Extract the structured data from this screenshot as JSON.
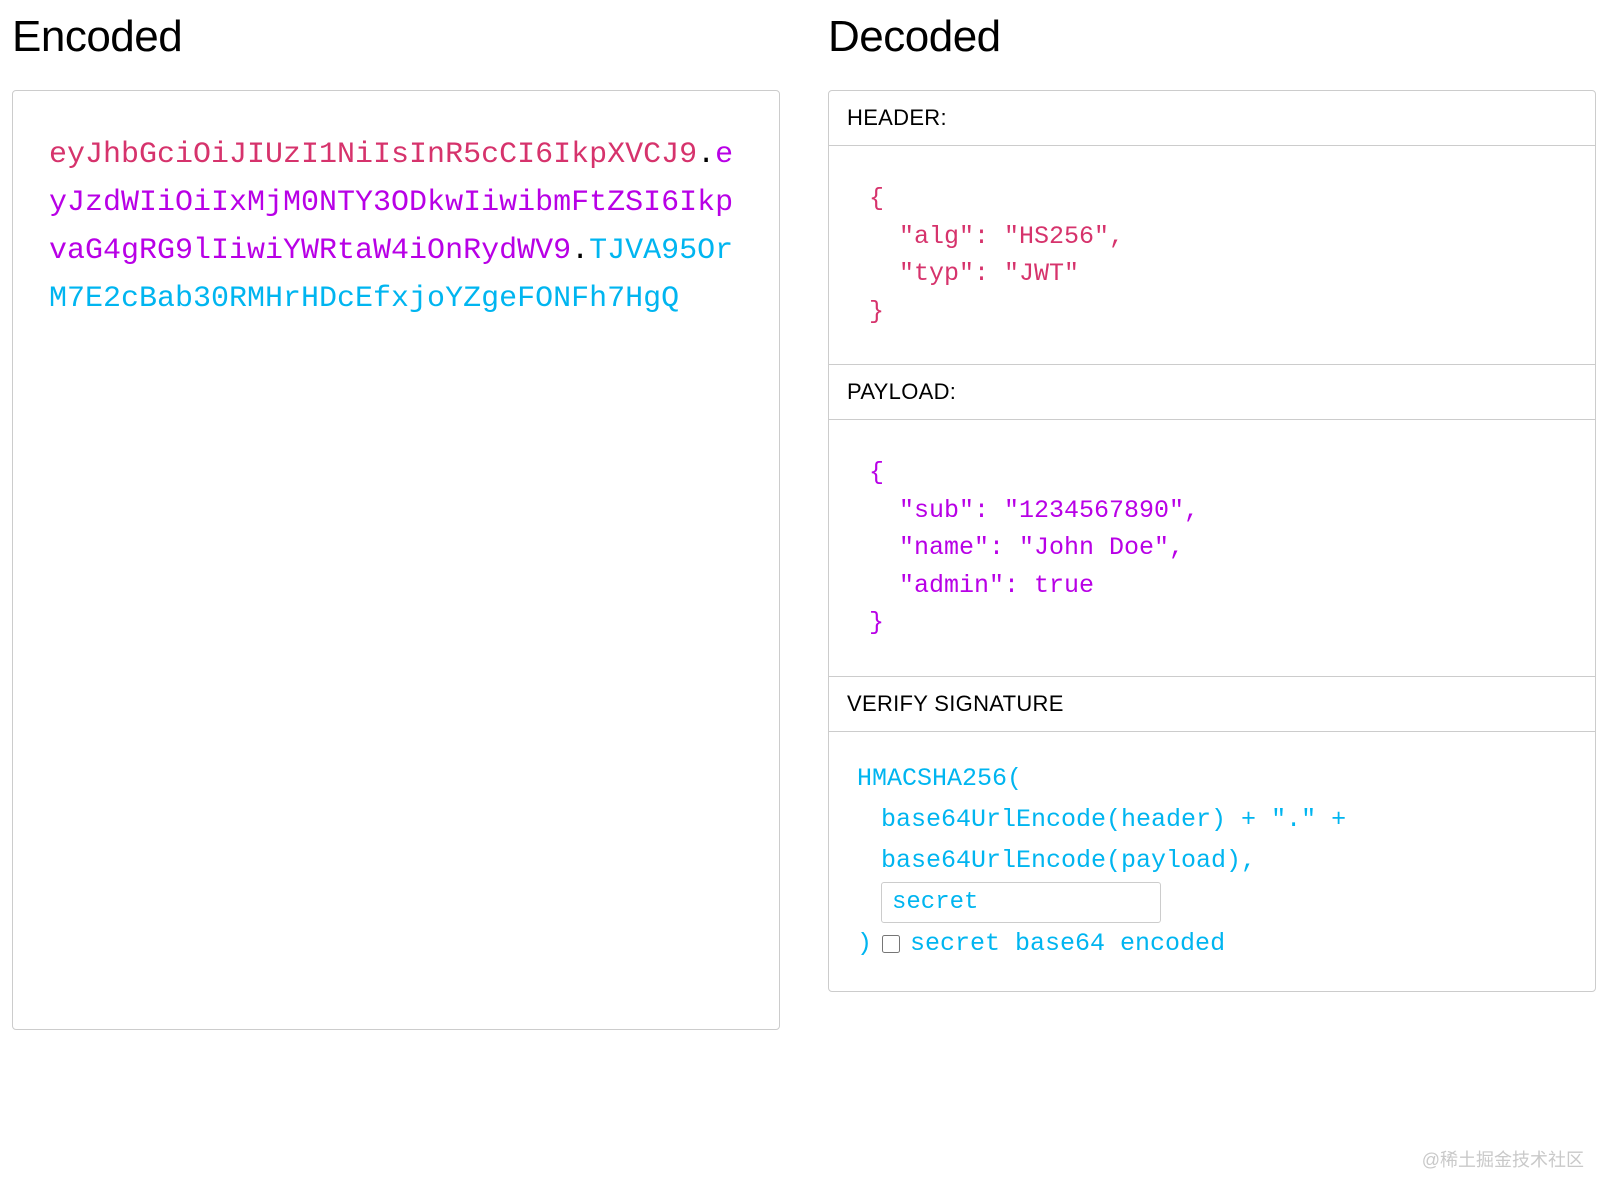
{
  "titles": {
    "encoded": "Encoded",
    "decoded": "Decoded"
  },
  "token": {
    "header": "eyJhbGciOiJIUzI1NiIsInR5cCI6IkpXVCJ9",
    "payload": "eyJzdWIiOiIxMjM0NTY3ODkwIiwibmFtZSI6IkpvaG4gRG9lIiwiYWRtaW4iOnRydWV9",
    "signature": "TJVA95OrM7E2cBab30RMHrHDcEfxjoYZgeFONFh7HgQ"
  },
  "sections": {
    "header_label": "HEADER:",
    "payload_label": "PAYLOAD:",
    "signature_label": "VERIFY SIGNATURE"
  },
  "decoded": {
    "header_json": "{\n  \"alg\": \"HS256\",\n  \"typ\": \"JWT\"\n}",
    "payload_json": "{\n  \"sub\": \"1234567890\",\n  \"name\": \"John Doe\",\n  \"admin\": true\n}"
  },
  "signature": {
    "line1": "HMACSHA256(",
    "line2": "base64UrlEncode(header) + \".\" +",
    "line3": "base64UrlEncode(payload),",
    "secret_value": "secret",
    "close_paren": ")",
    "base64_label": "secret base64 encoded"
  },
  "colors": {
    "header": "#d6336c",
    "payload": "#b800e6",
    "signature": "#00b5f0"
  },
  "watermark": "@稀土掘金技术社区"
}
